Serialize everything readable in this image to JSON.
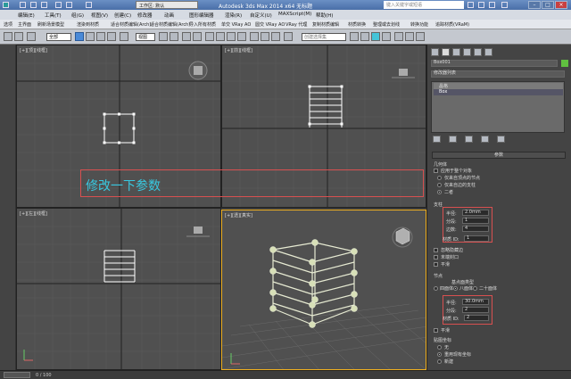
{
  "titlebar": {
    "workspace": "工作区: 默认",
    "title": "Autodesk 3ds Max  2014 x64      无标题",
    "search": "键入关键字或短语"
  },
  "menu": [
    "编辑(E)",
    "工具(T)",
    "组(G)",
    "视图(V)",
    "创建(C)",
    "修改器",
    "动画",
    "图形编辑器",
    "渲染(R)",
    "自定义(U)",
    "MAXScript(M)",
    "帮助(H)"
  ],
  "tabs": [
    "选项",
    "主界面",
    "刷新场景模型",
    "渲染到材质",
    "适合材质编辑(Arch)",
    "适合材质编辑(Arch)",
    "导入所有材质",
    "单交 VRay AO",
    "圆交 VRay AO",
    "VRay 代理",
    "复制材质编辑",
    "材质转换",
    "整理或去划线",
    "转换功能",
    "追踪材质(VRaM)"
  ],
  "toolbar": {
    "selection_filter": "全部",
    "view": "视图",
    "selection_set": "创建选择集"
  },
  "viewports": {
    "top_left_label": "[+][顶][线框]",
    "top_right_label": "[+][前][线框]",
    "bottom_left_label": "[+][左][线框]",
    "bottom_right_label": "[+][透][真实]"
  },
  "annotation": "修改一下参数",
  "command_panel": {
    "object_name": "Box001",
    "modifier_list": "修改器列表",
    "stack_item_1": "晶格",
    "stack_item_2": "Box",
    "params_header": "参数",
    "geometry_label": "几何体",
    "apply_whole": "应用于整个对象",
    "opt_joints_only": "仅来自顶点的节点",
    "opt_struts_only": "仅来自边的支柱",
    "opt_both": "二者",
    "struts_label": "支柱",
    "radius_label": "半径:",
    "radius_value": "2.0mm",
    "segments_label": "分段:",
    "segments_value": "1",
    "sides_label": "边数:",
    "sides_value": "4",
    "material_id_label": "材质 ID:",
    "material_id_value": "1",
    "ignore_hidden": "忽略隐藏边",
    "end_caps": "末端封口",
    "smooth": "平滑",
    "joints_label": "节点",
    "base_type_label": "基点面类型",
    "type_tetra": "四面体",
    "type_octa": "八面体",
    "type_icosa": "二十面体",
    "joint_radius_value": "30.0mm",
    "joint_segments_value": "2",
    "joint_material_value": "2",
    "joint_smooth": "平滑",
    "mapping_label": "贴图坐标",
    "map_none": "无",
    "map_reuse": "重用现有坐标",
    "map_new": "新建"
  },
  "status": {
    "frame": "0 / 100"
  }
}
